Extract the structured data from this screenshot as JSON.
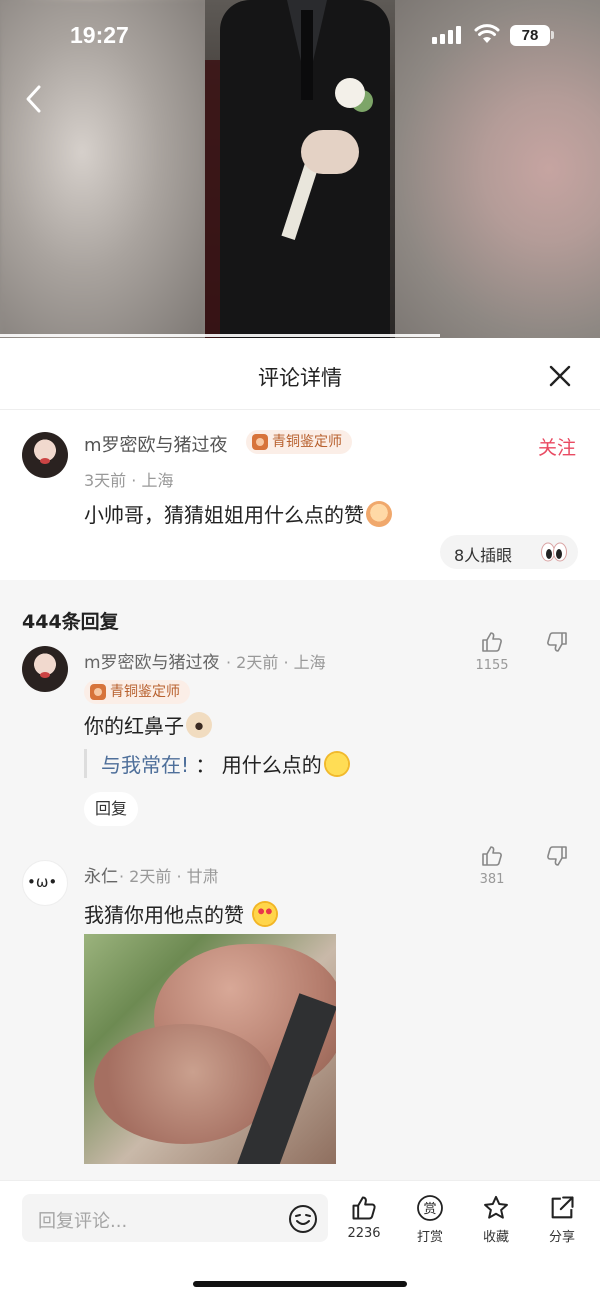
{
  "status_bar": {
    "time": "19:27",
    "battery": "78"
  },
  "sheet": {
    "title": "评论详情"
  },
  "main_comment": {
    "user": "m罗密欧与猪过夜",
    "badge": "青铜鉴定师",
    "follow": "关注",
    "meta": "3天前 · 上海",
    "text": "小帅哥，猜猜姐姐用什么点的赞",
    "peek": "8人插眼"
  },
  "replies": {
    "count_label": "444条回复",
    "items": [
      {
        "user": "m罗密欧与猪过夜",
        "meta": "· 2天前 · 上海",
        "badge": "青铜鉴定师",
        "text": "你的红鼻子",
        "likes": "1155",
        "quote_user": "与我常在!",
        "quote_sep": "：",
        "quote_text": "用什么点的",
        "reply_label": "回复"
      },
      {
        "user": "永仁",
        "meta": "· 2天前 · 甘肃",
        "text": "我猜你用他点的赞",
        "likes": "381"
      }
    ]
  },
  "bottom_bar": {
    "input_placeholder": "回复评论...",
    "like_count": "2236",
    "tip_label": "打赏",
    "collect_label": "收藏",
    "share_label": "分享"
  },
  "colors": {
    "follow": "#e94a62",
    "quote_user": "#4e6f9a",
    "badge": "#b8612f"
  },
  "icons": [
    "back-icon",
    "close-icon",
    "thumb-up-icon",
    "thumb-down-icon",
    "emoji-icon",
    "reward-icon",
    "star-icon",
    "share-icon",
    "signal-icon",
    "wifi-icon"
  ]
}
